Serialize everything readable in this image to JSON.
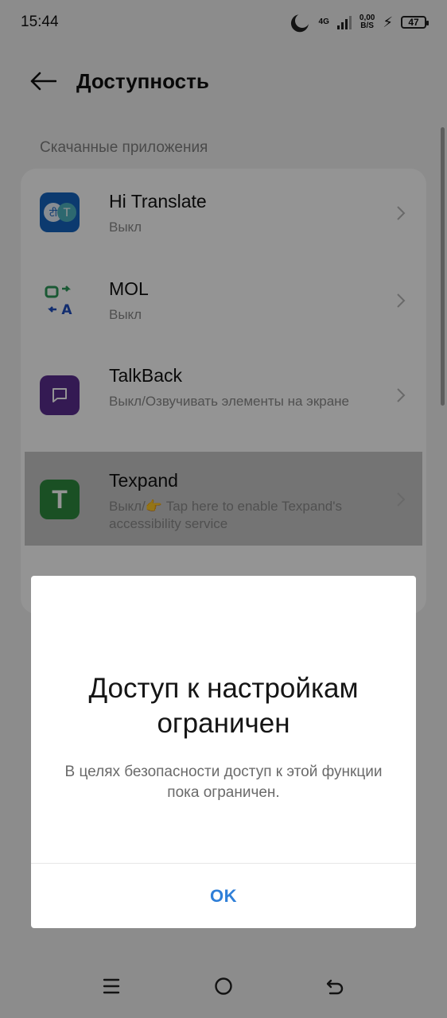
{
  "status_bar": {
    "time": "15:44",
    "network": "4G",
    "speed_value": "0,00",
    "speed_unit": "B/S",
    "battery": "47"
  },
  "header": {
    "title": "Доступность"
  },
  "section": {
    "title": "Скачанные приложения"
  },
  "apps": [
    {
      "name": "Hi Translate",
      "status": "Выкл",
      "icon": "hi-translate-icon"
    },
    {
      "name": "MOL",
      "status": "Выкл",
      "icon": "mol-translate-icon"
    },
    {
      "name": "TalkBack",
      "status": "Выкл/Озвучивать элементы на экране",
      "icon": "talkback-icon"
    },
    {
      "name": "Texpand",
      "status": "Выкл/👉 Tap here to enable Texpand's accessibility service",
      "icon": "texpand-icon"
    }
  ],
  "dialog": {
    "title": "Доступ к настройкам ограничен",
    "message": "В целях безопасности доступ к этой функции пока ограничен.",
    "ok_label": "OK"
  },
  "colors": {
    "accent": "#2f7fd8",
    "talkback": "#5b2d90",
    "texpand": "#2e8b3e",
    "hi_translate": "#1565c0"
  }
}
